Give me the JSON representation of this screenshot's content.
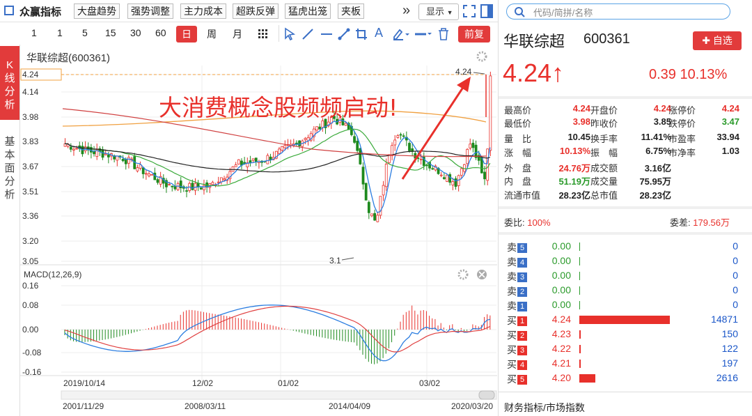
{
  "toolbar": {
    "app_name": "众赢指标",
    "buttons": [
      "大盘趋势",
      "强势调整",
      "主力成本",
      "超跌反弹",
      "猛虎出笼",
      "夹板"
    ],
    "more": "»",
    "show_label": "显示"
  },
  "periods": [
    "1",
    "1",
    "5",
    "15",
    "30",
    "60",
    "日",
    "周",
    "月"
  ],
  "fuquan": "前复",
  "left_tabs": {
    "k": "K线分析",
    "basic": "基本面分析"
  },
  "chart": {
    "title": "华联综超(600361)",
    "annotation": "大消费概念股频频启动!",
    "price_axis": [
      "4.24",
      "4.14",
      "3.98",
      "3.83",
      "3.67",
      "3.51",
      "3.36",
      "3.20",
      "3.05"
    ],
    "high_label": "4.24",
    "low_label": "3.1",
    "macd_title": "MACD(12,26,9)",
    "macd_axis": [
      "0.16",
      "0.08",
      "0.00",
      "-0.08",
      "-0.16"
    ],
    "date_axis": [
      "2019/10/14",
      "12/02",
      "01/02",
      "03/02"
    ],
    "range_axis": [
      "2001/11/29",
      "2008/03/11",
      "2014/04/09",
      "2020/03/20"
    ]
  },
  "chart_data": {
    "type": "candlestick",
    "title": "华联综超(600361)",
    "y_ticks": [
      4.24,
      4.14,
      3.98,
      3.83,
      3.67,
      3.51,
      3.36,
      3.2,
      3.05
    ],
    "ylim": [
      3.05,
      4.24
    ],
    "last_close": 4.24,
    "period_high": 4.24,
    "period_low": 3.1,
    "x_ticks": [
      "2019/10/14",
      "12/02",
      "01/02",
      "03/02"
    ],
    "macd": {
      "name": "MACD(12,26,9)",
      "y_ticks": [
        0.16,
        0.08,
        0.0,
        -0.08,
        -0.16
      ],
      "ylim": [
        -0.16,
        0.16
      ]
    }
  },
  "search": {
    "placeholder": "代码/简拼/名称"
  },
  "quote": {
    "name": "华联综超",
    "code": "600361",
    "add_watch": "✚ 自选",
    "price": "4.24↑",
    "change": "0.39 10.13%",
    "fields": [
      {
        "l": "最高价",
        "v": "4.24",
        "c": "red"
      },
      {
        "l": "开盘价",
        "v": "4.24",
        "c": "red"
      },
      {
        "l": "涨停价",
        "v": "4.24",
        "c": "red"
      },
      {
        "l": "最低价",
        "v": "3.98",
        "c": "red"
      },
      {
        "l": "昨收价",
        "v": "3.85",
        "c": "dark"
      },
      {
        "l": "跌停价",
        "v": "3.47",
        "c": "green"
      },
      {
        "l": "量　比",
        "v": "10.45",
        "c": "dark"
      },
      {
        "l": "换手率",
        "v": "11.41%",
        "c": "dark"
      },
      {
        "l": "市盈率",
        "v": "33.94",
        "c": "dark"
      },
      {
        "l": "涨　幅",
        "v": "10.13%",
        "c": "red"
      },
      {
        "l": "振　幅",
        "v": "6.75%",
        "c": "dark"
      },
      {
        "l": "市净率",
        "v": "1.03",
        "c": "dark"
      },
      {
        "l": "外　盘",
        "v": "24.76万",
        "c": "red"
      },
      {
        "l": "成交额",
        "v": "3.16亿",
        "c": "dark"
      },
      {
        "l": "",
        "v": "",
        "c": "dark"
      },
      {
        "l": "内　盘",
        "v": "51.19万",
        "c": "green"
      },
      {
        "l": "成交量",
        "v": "75.95万",
        "c": "dark"
      },
      {
        "l": "",
        "v": "",
        "c": "dark"
      },
      {
        "l": "流通市值",
        "v": "28.23亿",
        "c": "dark"
      },
      {
        "l": "总市值",
        "v": "28.23亿",
        "c": "dark"
      },
      {
        "l": "",
        "v": "",
        "c": "dark"
      }
    ],
    "weibi_label": "委比:",
    "weibi_value": "100%",
    "weicha_label": "委差:",
    "weicha_value": "179.56万"
  },
  "orderbook": [
    {
      "side": "卖",
      "n": "5",
      "price": "0.00",
      "vol": "0",
      "bar": 0
    },
    {
      "side": "卖",
      "n": "4",
      "price": "0.00",
      "vol": "0",
      "bar": 0
    },
    {
      "side": "卖",
      "n": "3",
      "price": "0.00",
      "vol": "0",
      "bar": 0
    },
    {
      "side": "卖",
      "n": "2",
      "price": "0.00",
      "vol": "0",
      "bar": 0
    },
    {
      "side": "卖",
      "n": "1",
      "price": "0.00",
      "vol": "0",
      "bar": 0
    },
    {
      "side": "买",
      "n": "1",
      "price": "4.24",
      "vol": "14871",
      "bar": 14871
    },
    {
      "side": "买",
      "n": "2",
      "price": "4.23",
      "vol": "150",
      "bar": 150
    },
    {
      "side": "买",
      "n": "3",
      "price": "4.22",
      "vol": "122",
      "bar": 122
    },
    {
      "side": "买",
      "n": "4",
      "price": "4.21",
      "vol": "197",
      "bar": 197
    },
    {
      "side": "买",
      "n": "5",
      "price": "4.20",
      "vol": "2616",
      "bar": 2616
    }
  ],
  "footer": "财务指标/市场指数",
  "colors": {
    "accent": "#e23b3b",
    "up": "#e8302b",
    "down": "#2a9a2a",
    "link": "#1a56c8"
  }
}
